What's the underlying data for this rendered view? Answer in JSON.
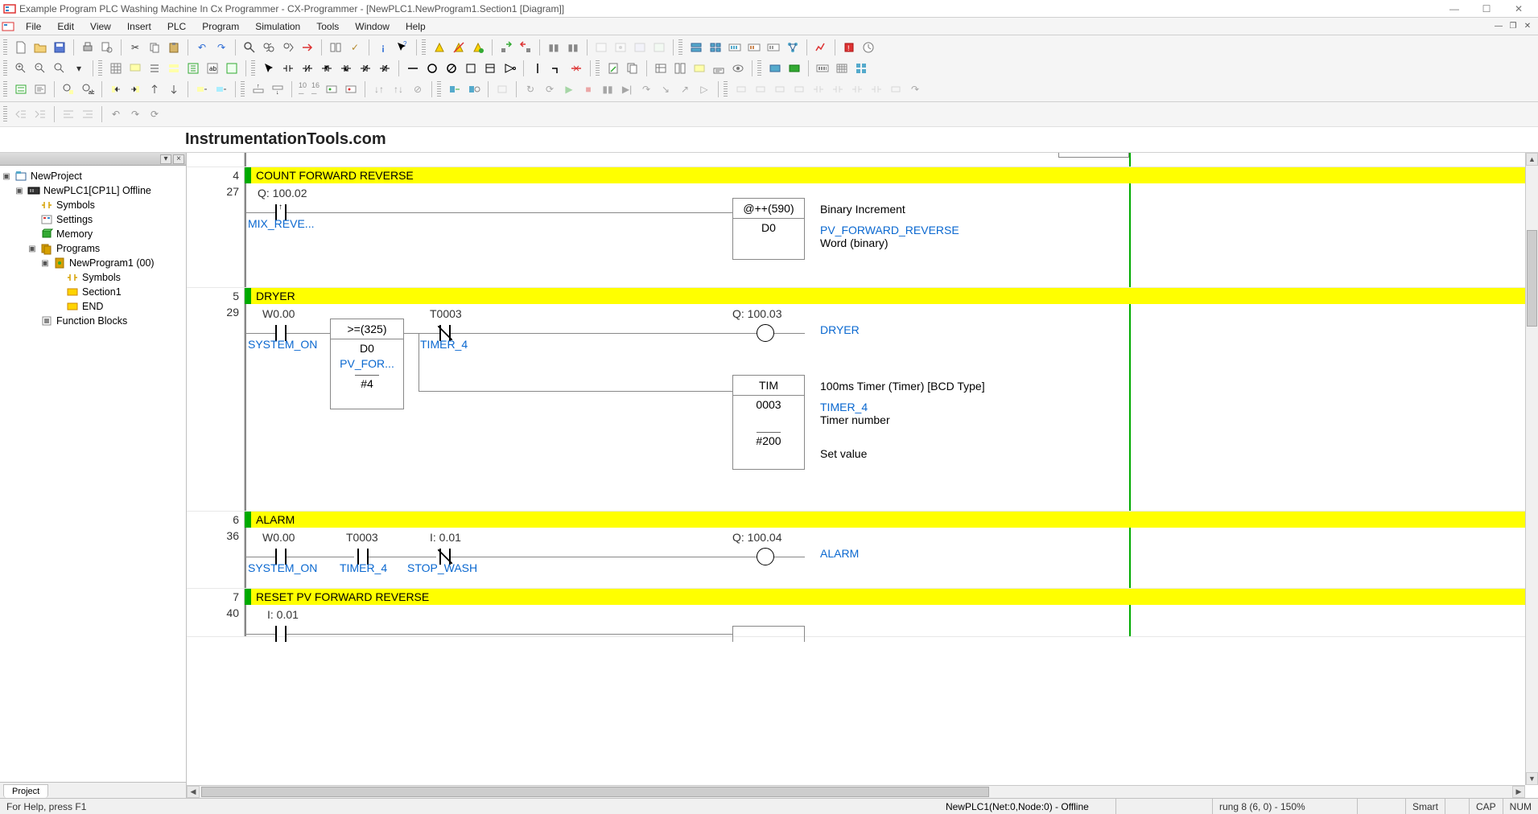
{
  "title": "Example Program PLC Washing Machine In Cx Programmer - CX-Programmer - [NewPLC1.NewProgram1.Section1 [Diagram]]",
  "menus": [
    "File",
    "Edit",
    "View",
    "Insert",
    "PLC",
    "Program",
    "Simulation",
    "Tools",
    "Window",
    "Help"
  ],
  "watermark": "InstrumentationTools.com",
  "tree": {
    "root": "NewProject",
    "plc": "NewPLC1[CP1L] Offline",
    "symbols": "Symbols",
    "settings": "Settings",
    "memory": "Memory",
    "programs": "Programs",
    "newprogram": "NewProgram1 (00)",
    "prog_symbols": "Symbols",
    "section1": "Section1",
    "end": "END",
    "function_blocks": "Function Blocks"
  },
  "sidebar_tab": "Project",
  "rungs": {
    "r4": {
      "num": "4",
      "step": "27",
      "title": "COUNT FORWARD REVERSE",
      "contact_addr": "Q: 100.02",
      "contact_name": "MIX_REVE...",
      "block_head": "@++(590)",
      "block_op": "D0",
      "comment1": "Binary Increment",
      "comment2": "PV_FORWARD_REVERSE",
      "comment3": "Word (binary)"
    },
    "r5": {
      "num": "5",
      "step": "29",
      "title": "DRYER",
      "c1_addr": "W0.00",
      "c1_name": "SYSTEM_ON",
      "cmp_head": ">=(325)",
      "cmp_op1": "D0",
      "cmp_op1_name": "PV_FOR...",
      "cmp_op2": "#4",
      "c2_addr": "T0003",
      "c2_name": "TIMER_4",
      "coil_addr": "Q: 100.03",
      "coil_name": "DRYER",
      "tim_head": "TIM",
      "tim_num": "0003",
      "tim_sv": "#200",
      "tim_comment1": "100ms Timer (Timer) [BCD Type]",
      "tim_comment2": "TIMER_4",
      "tim_comment3": "Timer number",
      "tim_comment4": "Set value"
    },
    "r6": {
      "num": "6",
      "step": "36",
      "title": "ALARM",
      "c1_addr": "W0.00",
      "c1_name": "SYSTEM_ON",
      "c2_addr": "T0003",
      "c2_name": "TIMER_4",
      "c3_addr": "I: 0.01",
      "c3_name": "STOP_WASH",
      "coil_addr": "Q: 100.04",
      "coil_name": "ALARM"
    },
    "r7": {
      "num": "7",
      "step": "40",
      "title": "RESET PV FORWARD REVERSE",
      "c1_addr": "I: 0.01"
    }
  },
  "status": {
    "help": "For Help, press F1",
    "connection": "NewPLC1(Net:0,Node:0) - Offline",
    "rung": "rung 8 (6, 0)  - 150%",
    "smart": "Smart",
    "cap": "CAP",
    "num": "NUM"
  }
}
